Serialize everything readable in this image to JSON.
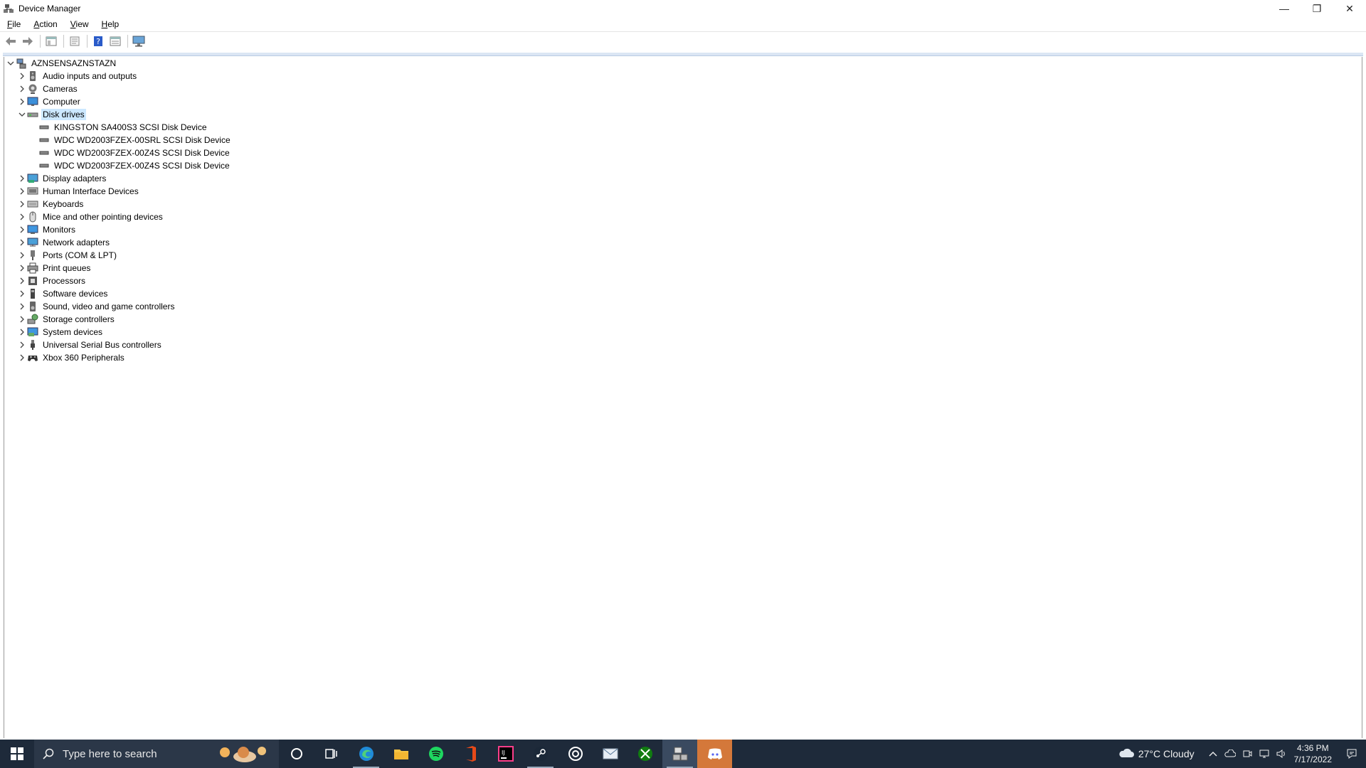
{
  "window": {
    "title": "Device Manager",
    "controls": {
      "minimize": "—",
      "restore": "❐",
      "close": "✕"
    }
  },
  "menu": [
    {
      "acc": "F",
      "rest": "ile"
    },
    {
      "acc": "A",
      "rest": "ction"
    },
    {
      "acc": "V",
      "rest": "iew"
    },
    {
      "acc": "H",
      "rest": "elp"
    }
  ],
  "toolbar_icons": [
    "back-icon",
    "forward-icon",
    "show-hide-tree-icon",
    "properties-icon",
    "help-icon",
    "details-view-icon",
    "monitor-scan-icon"
  ],
  "tree": {
    "root": "AZNSENSAZNSTAZN",
    "categories": [
      {
        "label": "Audio inputs and outputs",
        "icon": "speaker-icon"
      },
      {
        "label": "Cameras",
        "icon": "camera-icon"
      },
      {
        "label": "Computer",
        "icon": "computer-icon"
      },
      {
        "label": "Disk drives",
        "icon": "disk-drive-icon",
        "expanded": true,
        "selected": true,
        "children": [
          "KINGSTON SA400S3 SCSI Disk Device",
          "WDC WD2003FZEX-00SRL SCSI Disk Device",
          "WDC WD2003FZEX-00Z4S SCSI Disk Device",
          "WDC WD2003FZEX-00Z4S SCSI Disk Device"
        ]
      },
      {
        "label": "Display adapters",
        "icon": "display-adapter-icon"
      },
      {
        "label": "Human Interface Devices",
        "icon": "hid-icon"
      },
      {
        "label": "Keyboards",
        "icon": "keyboard-icon"
      },
      {
        "label": "Mice and other pointing devices",
        "icon": "mouse-icon"
      },
      {
        "label": "Monitors",
        "icon": "monitor-icon"
      },
      {
        "label": "Network adapters",
        "icon": "network-adapter-icon"
      },
      {
        "label": "Ports (COM & LPT)",
        "icon": "port-icon"
      },
      {
        "label": "Print queues",
        "icon": "printer-icon"
      },
      {
        "label": "Processors",
        "icon": "processor-icon"
      },
      {
        "label": "Software devices",
        "icon": "software-device-icon"
      },
      {
        "label": "Sound, video and game controllers",
        "icon": "sound-controller-icon"
      },
      {
        "label": "Storage controllers",
        "icon": "storage-controller-icon"
      },
      {
        "label": "System devices",
        "icon": "system-device-icon"
      },
      {
        "label": "Universal Serial Bus controllers",
        "icon": "usb-icon"
      },
      {
        "label": "Xbox 360 Peripherals",
        "icon": "gamepad-icon"
      }
    ]
  },
  "taskbar": {
    "search_placeholder": "Type here to search",
    "apps": [
      "cortana-icon",
      "task-view-icon",
      "edge-icon",
      "file-explorer-icon",
      "spotify-icon",
      "office-icon",
      "jetbrains-icon",
      "steam-icon",
      "ubisoft-icon",
      "mail-icon",
      "xbox-icon",
      "device-manager-taskbar-icon",
      "discord-icon"
    ],
    "weather": "27°C  Cloudy",
    "time": "4:36 PM",
    "date": "7/17/2022"
  },
  "colors": {
    "selection": "#cce8ff",
    "taskbar": "#1e2a3a"
  }
}
